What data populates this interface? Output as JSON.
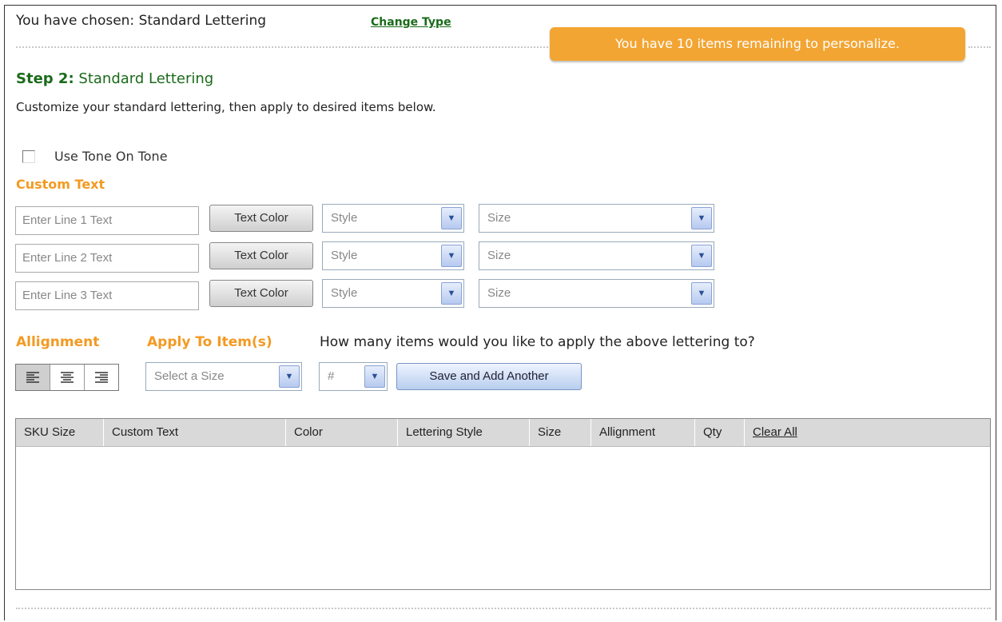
{
  "header": {
    "chosen_text": "You have chosen: Standard Lettering",
    "change_type_link": "Change Type",
    "remaining_notice": "You have 10 items remaining to personalize."
  },
  "step": {
    "label": "Step 2:",
    "title": "Standard Lettering",
    "description": "Customize your standard lettering, then apply to desired items below."
  },
  "tone_on_tone": {
    "label": "Use Tone On Tone",
    "checked": false
  },
  "custom_text": {
    "heading": "Custom Text",
    "lines": [
      {
        "placeholder": "Enter Line 1 Text",
        "color_button": "Text Color",
        "style_value": "Style",
        "size_value": "Size"
      },
      {
        "placeholder": "Enter Line 2 Text",
        "color_button": "Text Color",
        "style_value": "Style",
        "size_value": "Size"
      },
      {
        "placeholder": "Enter Line 3 Text",
        "color_button": "Text Color",
        "style_value": "Style",
        "size_value": "Size"
      }
    ]
  },
  "alignment": {
    "heading": "Allignment",
    "active": "left"
  },
  "apply": {
    "heading": "Apply To Item(s)",
    "question": "How many items would you like to apply the above lettering to?",
    "size_select": "Select a Size",
    "qty_select": "#",
    "save_button": "Save and Add Another"
  },
  "table": {
    "columns": [
      "SKU Size",
      "Custom Text",
      "Color",
      "Lettering Style",
      "Size",
      "Allignment",
      "Qty",
      "Clear All"
    ]
  },
  "colors": {
    "accent_orange": "#f39a22",
    "notice_bg": "#f3a533",
    "step_green": "#1a6a1a"
  },
  "icons": {
    "align_left": "align-left-icon",
    "align_center": "align-center-icon",
    "align_right": "align-right-icon",
    "dropdown": "chevron-down-icon"
  }
}
